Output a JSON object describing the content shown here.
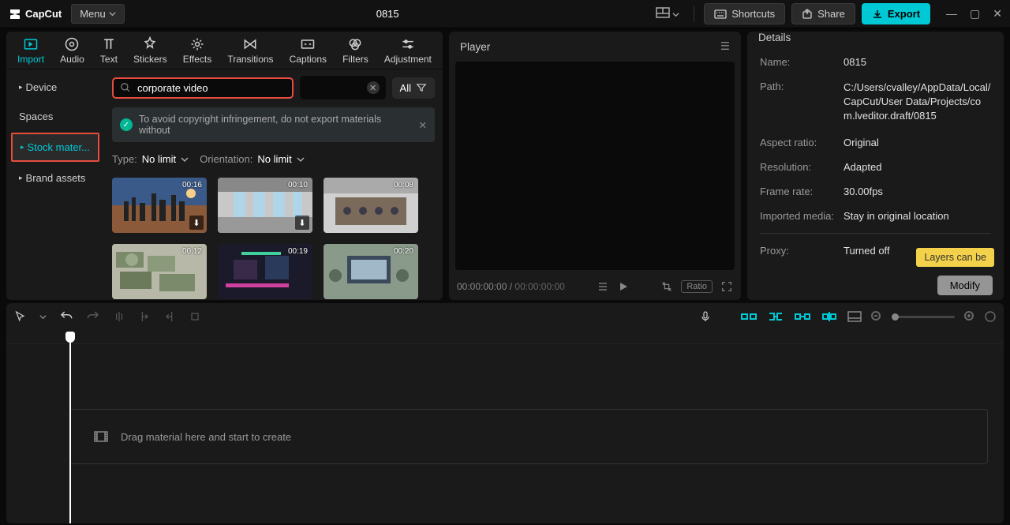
{
  "app": {
    "name": "CapCut",
    "menu_label": "Menu",
    "project_title": "0815"
  },
  "titlebar": {
    "shortcuts": "Shortcuts",
    "share": "Share",
    "export": "Export"
  },
  "tool_tabs": [
    {
      "label": "Import"
    },
    {
      "label": "Audio"
    },
    {
      "label": "Text"
    },
    {
      "label": "Stickers"
    },
    {
      "label": "Effects"
    },
    {
      "label": "Transitions"
    },
    {
      "label": "Captions"
    },
    {
      "label": "Filters"
    },
    {
      "label": "Adjustment"
    }
  ],
  "sidebar": {
    "items": [
      {
        "label": "Device",
        "has_chevron": true
      },
      {
        "label": "Spaces",
        "has_chevron": false
      },
      {
        "label": "Stock mater...",
        "has_chevron": true,
        "active": true
      },
      {
        "label": "Brand assets",
        "has_chevron": true
      }
    ]
  },
  "search": {
    "value": "corporate video",
    "all_label": "All"
  },
  "notice": {
    "text": "To avoid copyright infringement, do not export materials without"
  },
  "filters": {
    "type_label": "Type:",
    "type_value": "No limit",
    "orient_label": "Orientation:",
    "orient_value": "No limit"
  },
  "thumbs": [
    {
      "duration": "00:16"
    },
    {
      "duration": "00:10"
    },
    {
      "duration": "00:08"
    },
    {
      "duration": "00:12"
    },
    {
      "duration": "00:19"
    },
    {
      "duration": "00:20"
    }
  ],
  "player": {
    "title": "Player",
    "time_current": "00:00:00:00",
    "time_total": "00:00:00:00",
    "ratio_label": "Ratio"
  },
  "details": {
    "title": "Details",
    "rows": {
      "name_label": "Name:",
      "name_value": "0815",
      "path_label": "Path:",
      "path_value": "C:/Users/cvalley/AppData/Local/CapCut/User Data/Projects/com.lveditor.draft/0815",
      "aspect_label": "Aspect ratio:",
      "aspect_value": "Original",
      "res_label": "Resolution:",
      "res_value": "Adapted",
      "fps_label": "Frame rate:",
      "fps_value": "30.00fps",
      "media_label": "Imported media:",
      "media_value": "Stay in original location",
      "proxy_label": "Proxy:",
      "proxy_value": "Turned off"
    },
    "tooltip": "Layers can be",
    "modify": "Modify"
  },
  "timeline": {
    "placeholder": "Drag material here and start to create"
  }
}
